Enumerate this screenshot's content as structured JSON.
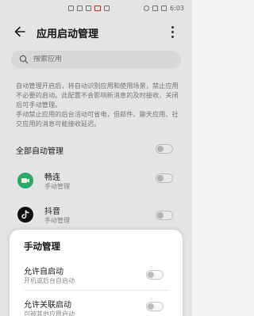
{
  "status_bar": {
    "time": "6:03"
  },
  "header": {
    "title": "应用启动管理"
  },
  "search": {
    "placeholder": "搜索应用"
  },
  "description": {
    "line1": "自动管理开启后，将自动识别应用和使用场景，禁止应用不必要的启动。此配置不会影响新消息的及时接收，关闭后可手动管理。",
    "line2": "手动禁止应用的后台活动可省电，但邮件、聊天应用、社交应用的消息可能接收延迟。"
  },
  "all_auto": {
    "label": "全部自动管理",
    "enabled": false
  },
  "apps": [
    {
      "name": "畅连",
      "status": "手动管理",
      "icon": "changlian-app-icon",
      "color": "#2bb36b",
      "enabled": false
    },
    {
      "name": "抖音",
      "status": "手动管理",
      "icon": "douyin-app-icon",
      "color": "#111111",
      "enabled": false
    }
  ],
  "sheet": {
    "title": "手动管理",
    "options": [
      {
        "label": "允许自启动",
        "sub": "开机或后台自启动",
        "enabled": false
      },
      {
        "label": "允许关联启动",
        "sub": "可被其他应用启动",
        "enabled": false
      }
    ]
  }
}
